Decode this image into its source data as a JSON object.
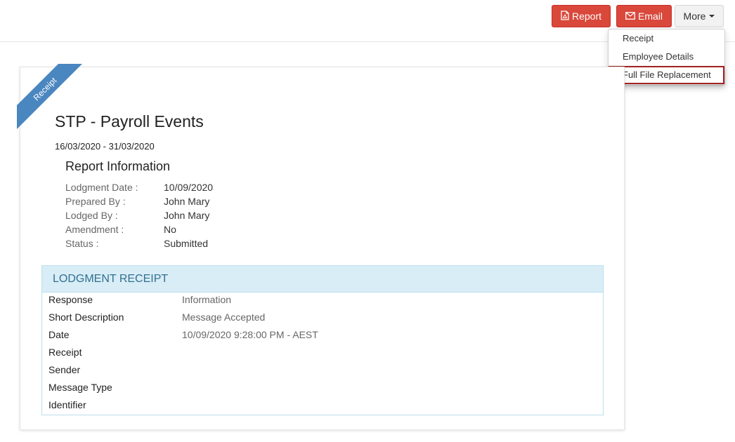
{
  "toolbar": {
    "report_label": "Report",
    "email_label": "Email",
    "more_label": "More",
    "report_icon": "pdf-file-icon",
    "email_icon": "envelope-icon",
    "danger_color": "#d9483b"
  },
  "more_menu": {
    "items": [
      {
        "label": "Receipt"
      },
      {
        "label": "Employee Details"
      },
      {
        "label": "Full File Replacement",
        "highlighted": true
      }
    ]
  },
  "card": {
    "ribbon": "Receipt",
    "title": "STP - Payroll Events",
    "period": "16/03/2020 - 31/03/2020",
    "report_info": {
      "heading": "Report Information",
      "rows": [
        {
          "label": "Lodgment Date :",
          "value": "10/09/2020"
        },
        {
          "label": "Prepared By :",
          "value": "John Mary"
        },
        {
          "label": "Lodged By :",
          "value": "John Mary"
        },
        {
          "label": "Amendment :",
          "value": "No"
        },
        {
          "label": "Status :",
          "value": "Submitted"
        }
      ]
    },
    "receipt": {
      "heading": "LODGMENT RECEIPT",
      "rows": [
        {
          "label": "Response",
          "value": "Information"
        },
        {
          "label": "Short Description",
          "value": "Message Accepted"
        },
        {
          "label": "Date",
          "value": "10/09/2020 9:28:00 PM - AEST"
        },
        {
          "label": "Receipt",
          "value": ""
        },
        {
          "label": "Sender",
          "value": ""
        },
        {
          "label": "Message Type",
          "value": ""
        },
        {
          "label": "Identifier",
          "value": ""
        }
      ]
    }
  }
}
